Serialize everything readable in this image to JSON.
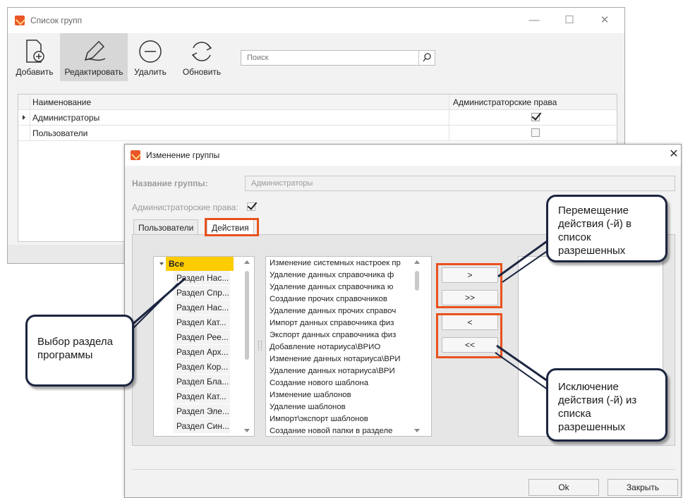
{
  "window_groups": {
    "title": "Список групп",
    "controls": {
      "minimize": "—",
      "maximize": "☐",
      "close": "✕"
    },
    "toolbar": {
      "add_label": "Добавить",
      "edit_label": "Редактировать",
      "delete_label": "Удалить",
      "refresh_label": "Обновить"
    },
    "search": {
      "placeholder": "Поиск",
      "value": ""
    },
    "grid": {
      "columns": [
        "Наименование",
        "Администраторские права"
      ],
      "rows": [
        {
          "name": "Администраторы",
          "admin": true,
          "selected": true
        },
        {
          "name": "Пользователи",
          "admin": false,
          "selected": false
        }
      ]
    }
  },
  "window_edit": {
    "title": "Изменение группы",
    "close": "✕",
    "group_name_label": "Название группы:",
    "group_name_value": "Администраторы",
    "admin_rights_label": "Администраторские права:",
    "admin_rights_checked": true,
    "tabs": [
      "Пользователи",
      "Действия"
    ],
    "active_tab": "Действия",
    "sections": {
      "root": "Все",
      "items": [
        "Раздел Нас...",
        "Раздел Спр...",
        "Раздел Нас...",
        "Раздел Кат...",
        "Раздел Рее...",
        "Раздел Арх...",
        "Раздел Кор...",
        "Раздел Бла...",
        "Раздел Кат...",
        "Раздел Эле...",
        "Раздел Син..."
      ]
    },
    "actions": [
      "Изменение системных настроек пр",
      "Удаление данных справочника ф",
      "Удаление данных справочника ю",
      "Создание прочих справочников",
      "Удаление данных прочих справоч",
      "Импорт данных справочника физ",
      "Экспорт данных справочника физ",
      "Добавление нотариуса\\ВРИО",
      "Изменение данных нотариуса\\ВРИ",
      "Удаление данных нотариуса\\ВРИ",
      "Создание нового шаблона",
      "Изменение шаблонов",
      "Удаление шаблонов",
      "Импорт\\экспорт шаблонов",
      "Создание новой папки в разделе"
    ],
    "move_buttons": {
      "add_one": ">",
      "add_all": ">>",
      "remove_one": "<",
      "remove_all": "<<"
    },
    "ok_label": "Ok",
    "close_label": "Закрыть"
  },
  "callouts": {
    "section_select": "Выбор раздела программы",
    "move_to_allowed": "Перемещение действия (-й) в список разрешенных",
    "exclude_from_allowed": "Исключение действия (-й) из списка разрешенных"
  },
  "colors": {
    "highlight": "#e8521d",
    "callout_border": "#1c2540",
    "selected_root": "#ffcc00",
    "app_icon": "#e8562a"
  }
}
